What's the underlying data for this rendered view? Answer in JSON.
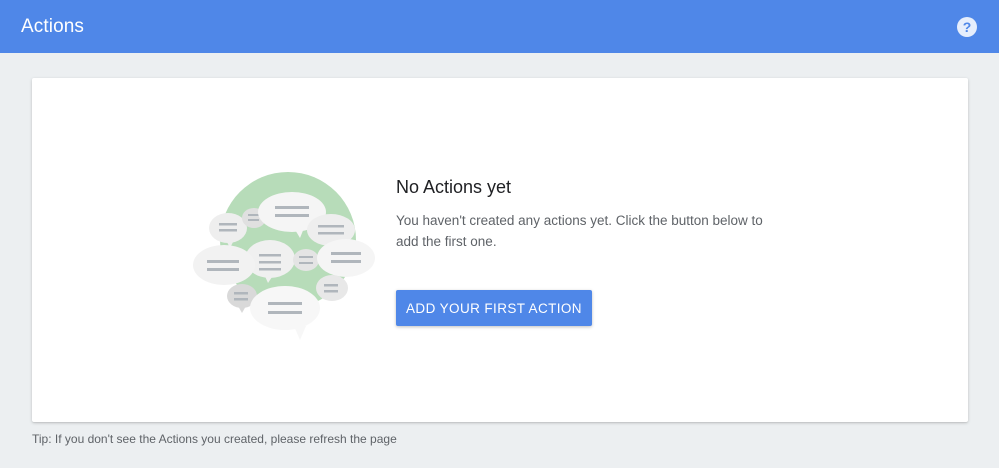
{
  "header": {
    "title": "Actions",
    "help_icon": "help-circle-icon",
    "accent_color": "#4f87e8"
  },
  "empty_state": {
    "illustration_icon": "chat-bubbles-illustration",
    "title": "No Actions yet",
    "description": "You haven't created any actions yet. Click the button below to add the first one.",
    "button_label": "ADD YOUR FIRST ACTION"
  },
  "footer": {
    "tip": "Tip: If you don't see the Actions you created, please refresh the page"
  }
}
